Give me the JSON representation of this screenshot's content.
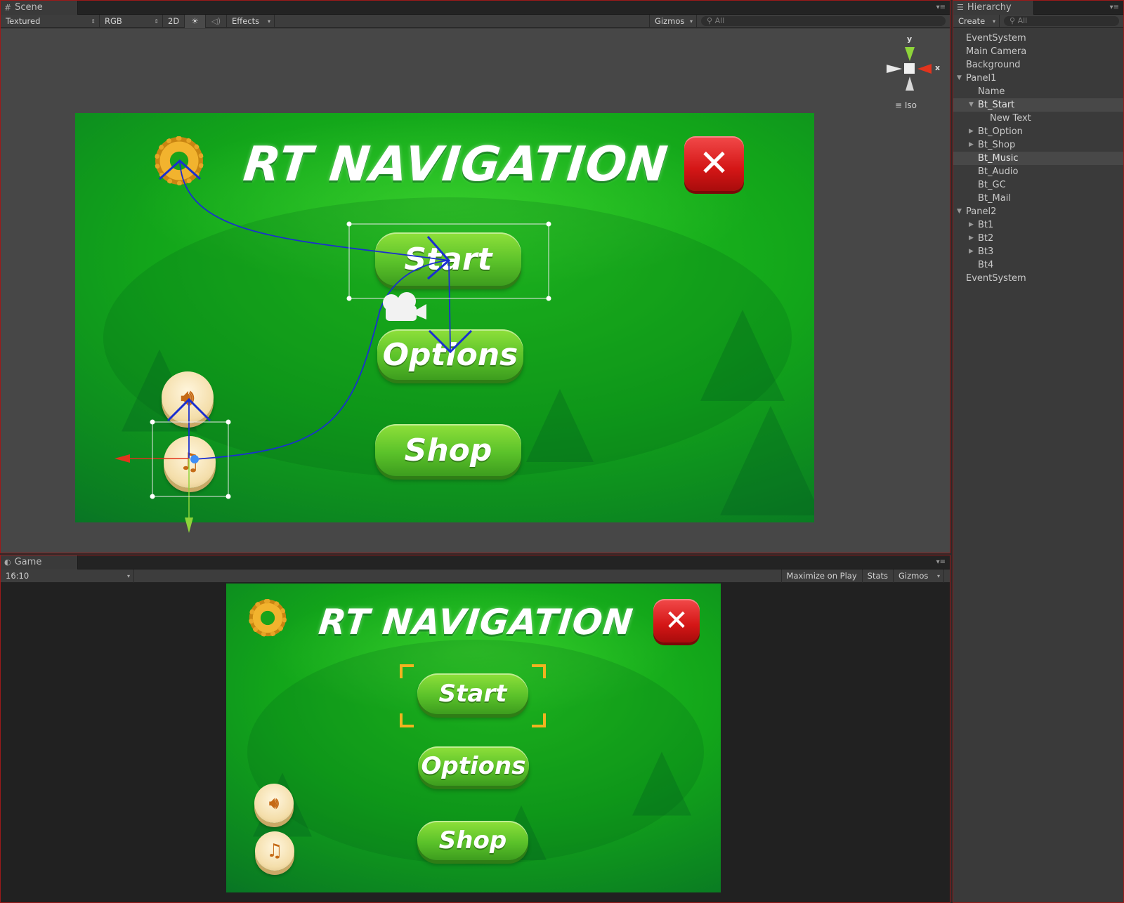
{
  "scene": {
    "tab_label": "Scene",
    "toolbar": {
      "shading_mode": "Textured",
      "render_mode": "RGB",
      "mode_2d": "2D",
      "lighting_icon": "sun-icon",
      "audio_icon": "speaker-icon",
      "effects_label": "Effects",
      "gizmos_label": "Gizmos",
      "search_placeholder": "All"
    },
    "axis_gizmo": {
      "y_label": "y",
      "x_label": "x",
      "projection_label": "Iso"
    }
  },
  "game_ui": {
    "title": "RT NAVIGATION",
    "start_label": "Start",
    "options_label": "Options",
    "shop_label": "Shop",
    "settings_icon": "gear-icon",
    "close_icon": "close-icon",
    "audio_icon": "speaker-icon",
    "music_icon": "music-note-icon"
  },
  "game": {
    "tab_label": "Game",
    "aspect_label": "16:10",
    "maximize_label": "Maximize on Play",
    "stats_label": "Stats",
    "gizmos_label": "Gizmos"
  },
  "hierarchy": {
    "tab_label": "Hierarchy",
    "create_label": "Create",
    "search_placeholder": "All",
    "items": [
      {
        "label": "EventSystem",
        "depth": 0,
        "fold": "none",
        "selected": false
      },
      {
        "label": "Main Camera",
        "depth": 0,
        "fold": "none",
        "selected": false
      },
      {
        "label": "Background",
        "depth": 0,
        "fold": "none",
        "selected": false
      },
      {
        "label": "Panel1",
        "depth": 0,
        "fold": "open",
        "selected": false
      },
      {
        "label": "Name",
        "depth": 1,
        "fold": "none",
        "selected": false
      },
      {
        "label": "Bt_Start",
        "depth": 1,
        "fold": "open",
        "selected": true
      },
      {
        "label": "New Text",
        "depth": 2,
        "fold": "none",
        "selected": false
      },
      {
        "label": "Bt_Option",
        "depth": 1,
        "fold": "closed",
        "selected": false
      },
      {
        "label": "Bt_Shop",
        "depth": 1,
        "fold": "closed",
        "selected": false
      },
      {
        "label": "Bt_Music",
        "depth": 1,
        "fold": "none",
        "selected": true
      },
      {
        "label": "Bt_Audio",
        "depth": 1,
        "fold": "none",
        "selected": false
      },
      {
        "label": "Bt_GC",
        "depth": 1,
        "fold": "none",
        "selected": false
      },
      {
        "label": "Bt_Mail",
        "depth": 1,
        "fold": "none",
        "selected": false
      },
      {
        "label": "Panel2",
        "depth": 0,
        "fold": "open",
        "selected": false
      },
      {
        "label": "Bt1",
        "depth": 1,
        "fold": "closed",
        "selected": false
      },
      {
        "label": "Bt2",
        "depth": 1,
        "fold": "closed",
        "selected": false
      },
      {
        "label": "Bt3",
        "depth": 1,
        "fold": "closed",
        "selected": false
      },
      {
        "label": "Bt4",
        "depth": 1,
        "fold": "none",
        "selected": false
      },
      {
        "label": "EventSystem",
        "depth": 0,
        "fold": "none",
        "selected": false
      }
    ]
  },
  "colors": {
    "navigation_line": "#1a2fd0",
    "gizmo_x": "#e2341d",
    "gizmo_y": "#8ed43a",
    "selection_corners": "#f2b320",
    "panel_border": "#9c1a1a"
  }
}
